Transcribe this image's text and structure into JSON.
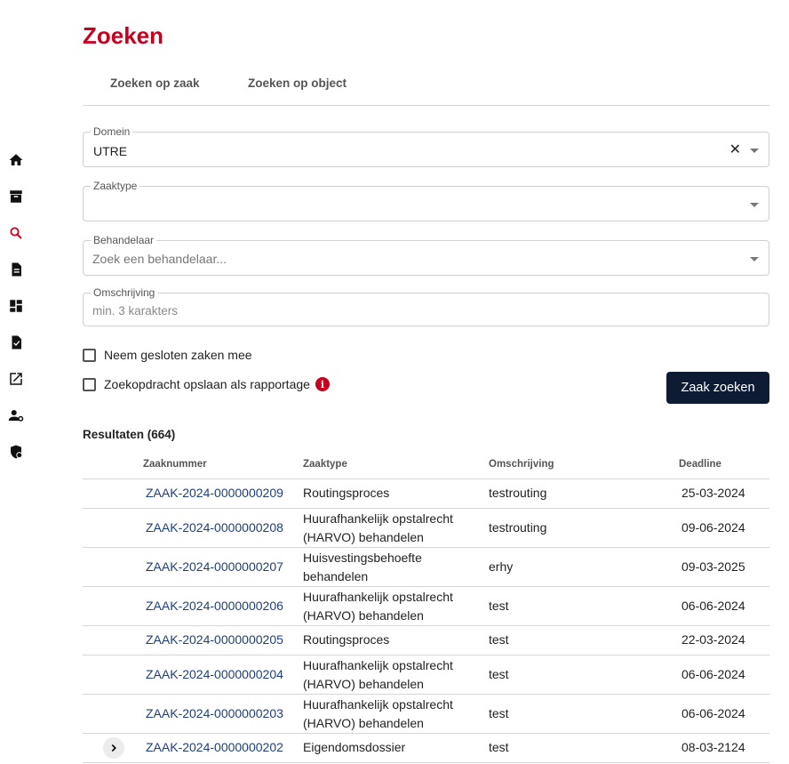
{
  "page": {
    "title": "Zoeken"
  },
  "nav": {
    "items": [
      {
        "icon": "home-icon",
        "active": false
      },
      {
        "icon": "archive-icon",
        "active": false
      },
      {
        "icon": "search-icon",
        "active": true
      },
      {
        "icon": "document-icon",
        "active": false
      },
      {
        "icon": "dashboard-icon",
        "active": false
      },
      {
        "icon": "file-icon",
        "active": false
      },
      {
        "icon": "external-link-icon",
        "active": false
      },
      {
        "icon": "user-settings-icon",
        "active": false
      },
      {
        "icon": "shield-icon",
        "active": false
      }
    ]
  },
  "tabs": [
    {
      "label": "Zoeken op zaak"
    },
    {
      "label": "Zoeken op object"
    }
  ],
  "form": {
    "domein": {
      "label": "Domein",
      "value": "UTRE"
    },
    "zaaktype": {
      "label": "Zaaktype",
      "value": ""
    },
    "behandelaar": {
      "label": "Behandelaar",
      "placeholder": "Zoek een behandelaar..."
    },
    "omschrijving": {
      "label": "Omschrijving",
      "placeholder": "min. 3 karakters"
    },
    "checkbox_gesloten": {
      "label": "Neem gesloten zaken mee",
      "checked": false
    },
    "checkbox_opslaan": {
      "label": "Zoekopdracht opslaan als rapportage",
      "checked": false
    },
    "info_glyph": "i",
    "clear_glyph": "✕",
    "search_button": "Zaak zoeken"
  },
  "results": {
    "title": "Resultaten (664)",
    "columns": [
      "Zaaknummer",
      "Zaaktype",
      "Omschrijving",
      "Deadline"
    ],
    "rows": [
      {
        "zaaknummer": "ZAAK-2024-0000000209",
        "zaaktype_lines": [
          "Routingsproces"
        ],
        "omschrijving": "testrouting",
        "deadline": "25-03-2024"
      },
      {
        "zaaknummer": "ZAAK-2024-0000000208",
        "zaaktype_lines": [
          "Huurafhankelijk opstalrecht",
          "(HARVO) behandelen"
        ],
        "omschrijving": "testrouting",
        "deadline": "09-06-2024"
      },
      {
        "zaaknummer": "ZAAK-2024-0000000207",
        "zaaktype_lines": [
          "Huisvestingsbehoefte",
          "behandelen"
        ],
        "omschrijving": "erhy",
        "deadline": "09-03-2025"
      },
      {
        "zaaknummer": "ZAAK-2024-0000000206",
        "zaaktype_lines": [
          "Huurafhankelijk opstalrecht",
          "(HARVO) behandelen"
        ],
        "omschrijving": "test",
        "deadline": "06-06-2024"
      },
      {
        "zaaknummer": "ZAAK-2024-0000000205",
        "zaaktype_lines": [
          "Routingsproces"
        ],
        "omschrijving": "test",
        "deadline": "22-03-2024"
      },
      {
        "zaaknummer": "ZAAK-2024-0000000204",
        "zaaktype_lines": [
          "Huurafhankelijk opstalrecht",
          "(HARVO) behandelen"
        ],
        "omschrijving": "test",
        "deadline": "06-06-2024"
      },
      {
        "zaaknummer": "ZAAK-2024-0000000203",
        "zaaktype_lines": [
          "Huurafhankelijk opstalrecht",
          "(HARVO) behandelen"
        ],
        "omschrijving": "test",
        "deadline": "06-06-2024"
      },
      {
        "zaaknummer": "ZAAK-2024-0000000202",
        "zaaktype_lines": [
          "Eigendomsdossier"
        ],
        "omschrijving": "test",
        "deadline": "08-03-2124",
        "expandable": true
      }
    ]
  },
  "colors": {
    "accent": "#c8001e",
    "button": "#0d1b33",
    "link": "#1f3f7a"
  }
}
